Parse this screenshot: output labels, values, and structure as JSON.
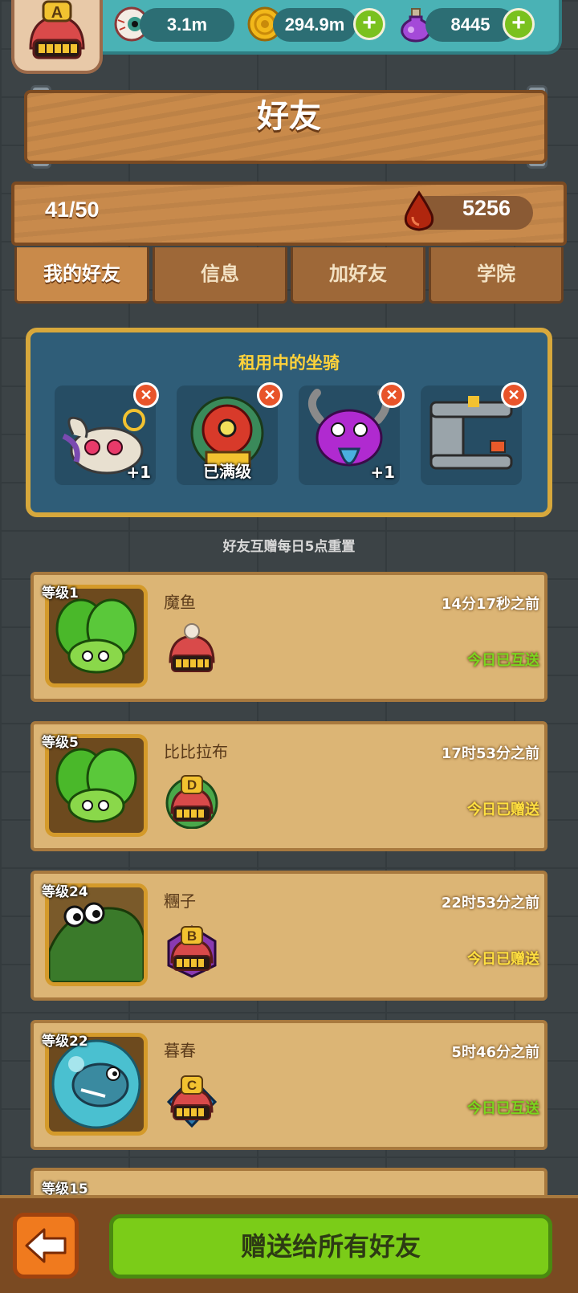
{
  "resources": {
    "eyes": "3.1m",
    "coins": "294.9m",
    "potions": "8445"
  },
  "player_rank": "A",
  "title": "好友",
  "friend_count": "41/50",
  "blood_points": "5256",
  "tabs": [
    "我的好友",
    "信息",
    "加好友",
    "学院"
  ],
  "active_tab": "我的好友",
  "mounts": {
    "title": "租用中的坐骑",
    "slots": [
      {
        "icon": "rabbit-mount-icon",
        "badge": "+1"
      },
      {
        "icon": "lion-dance-mount-icon",
        "badge": "已满级"
      },
      {
        "icon": "purple-demon-mount-icon",
        "badge": "+1"
      },
      {
        "icon": "robot-machine-mount-icon",
        "badge": ""
      }
    ]
  },
  "reset_note": "好友互赠每日5点重置",
  "friends": [
    {
      "level": "等级1",
      "name": "魔鱼",
      "time": "14分17秒之前",
      "status": "今日已互送",
      "status_color": "#7ad61e",
      "rank": "",
      "avatar": "lettuce-avatar-icon"
    },
    {
      "level": "等级5",
      "name": "比比拉布",
      "time": "17时53分之前",
      "status": "今日已赠送",
      "status_color": "#ffe040",
      "rank": "D",
      "avatar": "lettuce-avatar-icon"
    },
    {
      "level": "等级24",
      "name": "糰子",
      "time": "22时53分之前",
      "status": "今日已赠送",
      "status_color": "#ffe040",
      "rank": "B",
      "avatar": "frog-avatar-icon"
    },
    {
      "level": "等级22",
      "name": "暮春",
      "time": "5时46分之前",
      "status": "今日已互送",
      "status_color": "#7ad61e",
      "rank": "C",
      "avatar": "bubble-fish-avatar-icon"
    }
  ],
  "partial_friend_level": "等级15",
  "send_all_label": "赠送给所有好友"
}
